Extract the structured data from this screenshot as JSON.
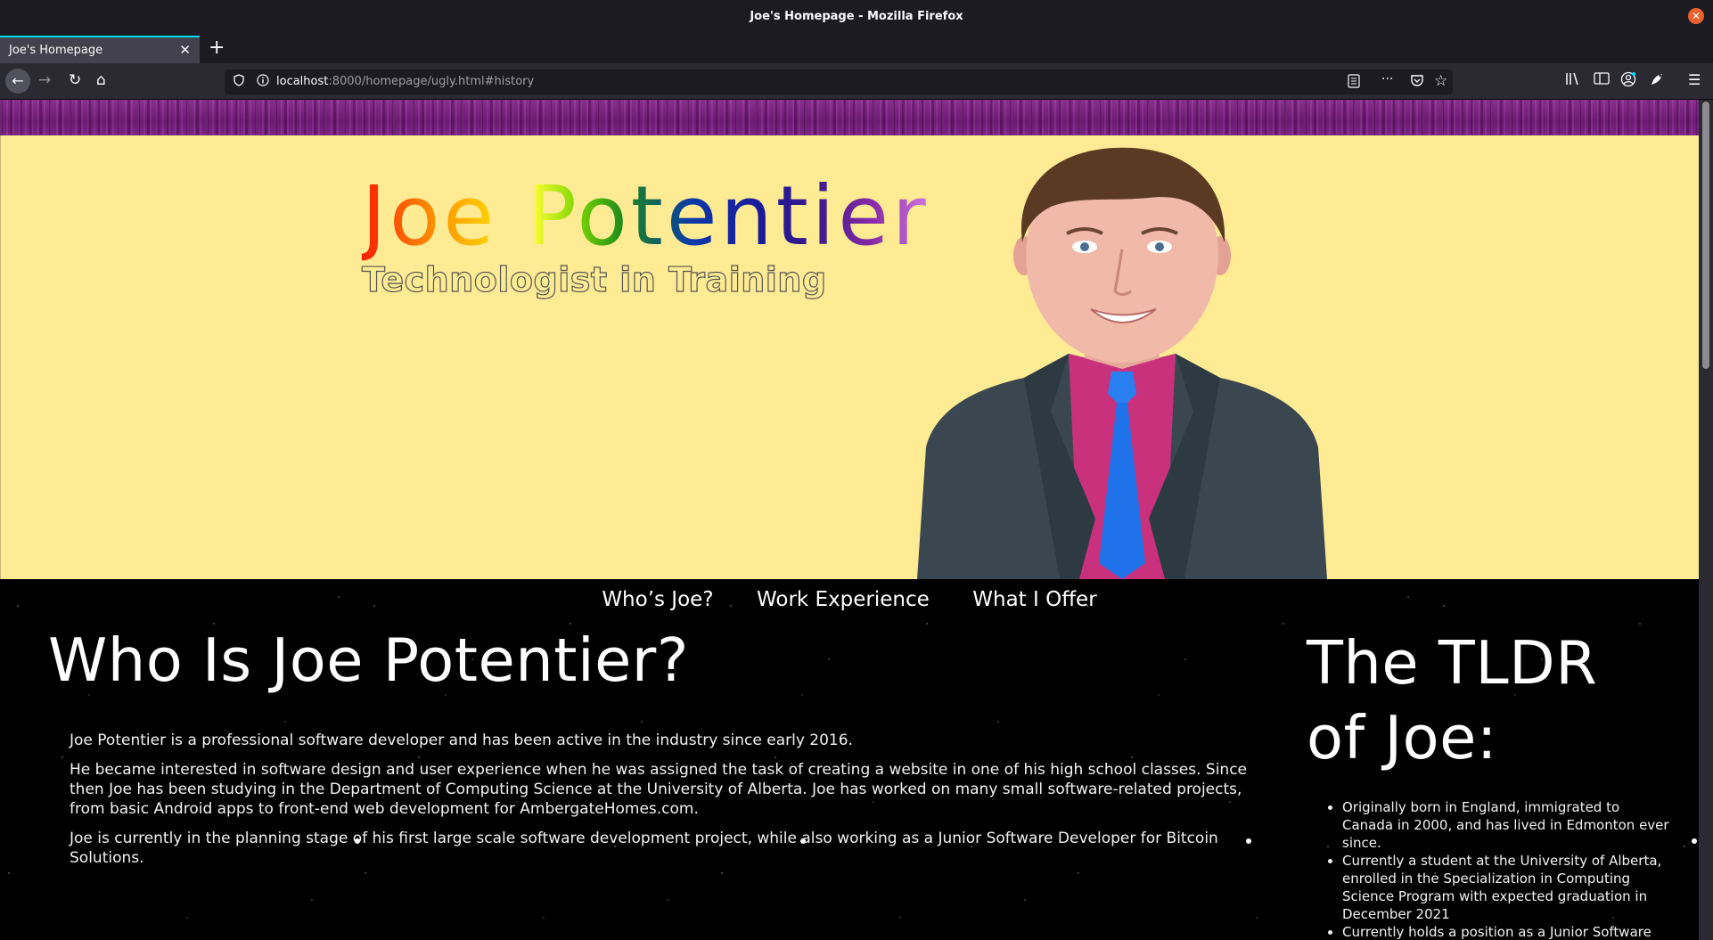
{
  "window": {
    "title": "Joe's Homepage - Mozilla Firefox",
    "close_glyph": "✕"
  },
  "tabs": [
    {
      "label": "Joe's Homepage",
      "close_glyph": "✕"
    }
  ],
  "new_tab_glyph": "+",
  "toolbar": {
    "back_glyph": "←",
    "forward_glyph": "→",
    "reload_glyph": "↻",
    "home_glyph": "⌂",
    "url_host": "localhost",
    "url_path": ":8000/homepage/ugly.html#history",
    "more_glyph": "···",
    "star_glyph": "☆",
    "menu_glyph": "☰"
  },
  "page": {
    "name": "Joe Potentier",
    "tagline": "Technologist in Training",
    "nav": [
      {
        "label": "Who’s Joe?"
      },
      {
        "label": "Work Experience"
      },
      {
        "label": "What I Offer"
      }
    ],
    "who": {
      "heading": "Who Is Joe Potentier?",
      "paragraphs": [
        "Joe Potentier is a professional software developer and has been active in the industry since early 2016.",
        "He became interested in software design and user experience when he was assigned the task of creating a website in one of his high school classes. Since then Joe has been studying in the Department of Computing Science at the University of Alberta. Joe has worked on many small software-related projects, from basic Android apps to front-end web development for AmbergateHomes.com.",
        "Joe is currently in the planning stage of his first large scale software development project, while also working as a Junior Software Developer for Bitcoin Solutions."
      ]
    },
    "tldr": {
      "heading": "The TLDR of Joe:",
      "items": [
        "Originally born in England, immigrated to Canada in 2000, and has lived in Edmonton ever since.",
        "Currently a student at the University of Alberta, enrolled in the Specialization in Computing Science Program with expected graduation in December 2021",
        "Currently holds a position as a Junior Software"
      ]
    }
  },
  "colors": {
    "hero_background": "#feeb93",
    "banner_purple": "#7c2483",
    "page_background": "#000000"
  }
}
